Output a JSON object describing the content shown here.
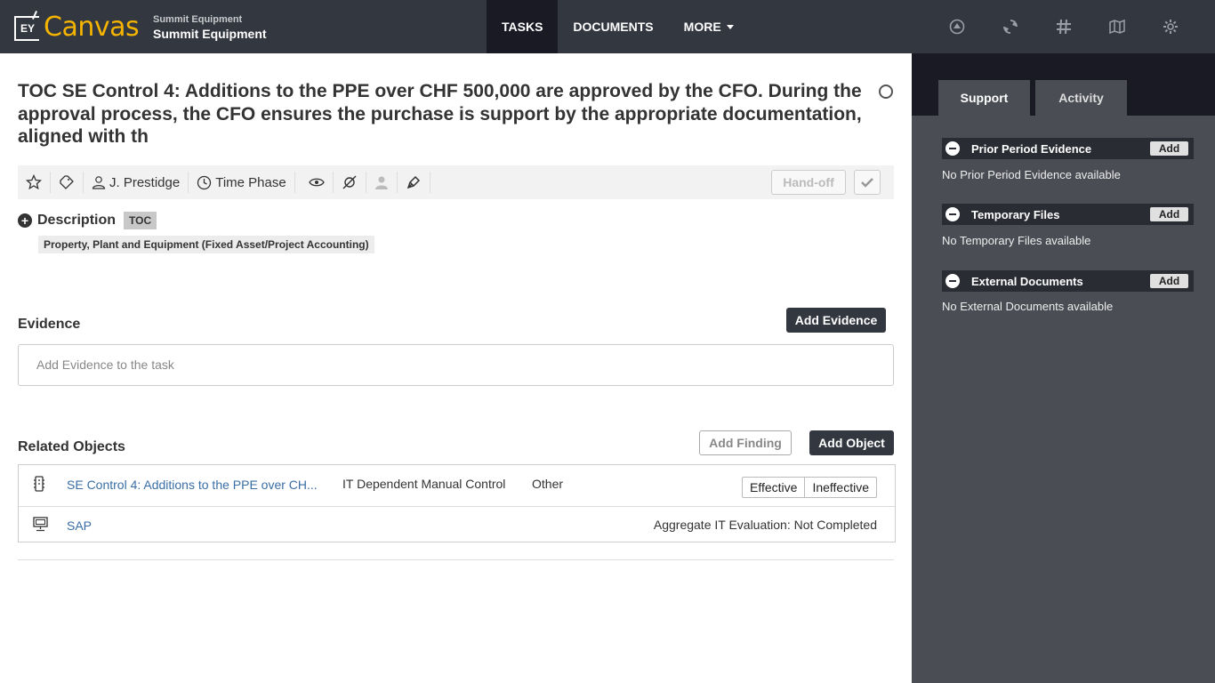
{
  "header": {
    "logo_text": "EY",
    "brand": "Canvas",
    "client_small": "Summit Equipment",
    "client_name": "Summit Equipment",
    "nav": [
      {
        "label": "TASKS",
        "active": true
      },
      {
        "label": "DOCUMENTS",
        "active": false
      },
      {
        "label": "MORE",
        "active": false
      }
    ],
    "icons": [
      "guidance-icon",
      "refresh-icon",
      "hash-icon",
      "map-icon",
      "settings-icon"
    ]
  },
  "task": {
    "title": "TOC SE Control 4: Additions to the PPE over CHF 500,000 are approved by the CFO. During the approval process, the CFO ensures the purchase is support by the appropriate documentation, aligned with th",
    "assignee": "J. Prestidge",
    "phase": "Time Phase",
    "handoff_label": "Hand-off",
    "description_label": "Description",
    "tag": "TOC",
    "account": "Property, Plant and Equipment (Fixed Asset/Project Accounting)"
  },
  "evidence": {
    "heading": "Evidence",
    "add_button": "Add Evidence",
    "placeholder": "Add Evidence to the task"
  },
  "related": {
    "heading": "Related Objects",
    "add_finding": "Add Finding",
    "add_object": "Add Object",
    "rows": [
      {
        "name": "SE Control 4: Additions to the PPE over CH...",
        "type": "IT Dependent Manual Control",
        "category": "Other",
        "effective": "Effective",
        "ineffective": "Ineffective"
      },
      {
        "name": "SAP",
        "aggregate_label": "Aggregate IT Evaluation:",
        "aggregate_value": "Not Completed"
      }
    ]
  },
  "sidebar": {
    "tabs": [
      {
        "label": "Support",
        "active": true
      },
      {
        "label": "Activity",
        "active": false
      }
    ],
    "sections": [
      {
        "title": "Prior Period Evidence",
        "add": "Add",
        "empty": "No Prior Period Evidence available"
      },
      {
        "title": "Temporary Files",
        "add": "Add",
        "empty": "No Temporary Files available"
      },
      {
        "title": "External Documents",
        "add": "Add",
        "empty": "No External Documents available"
      }
    ]
  },
  "colors": {
    "topbar": "#333740",
    "brand": "#f5b400",
    "link": "#3a6ea5",
    "panel": "#4a4d54"
  }
}
